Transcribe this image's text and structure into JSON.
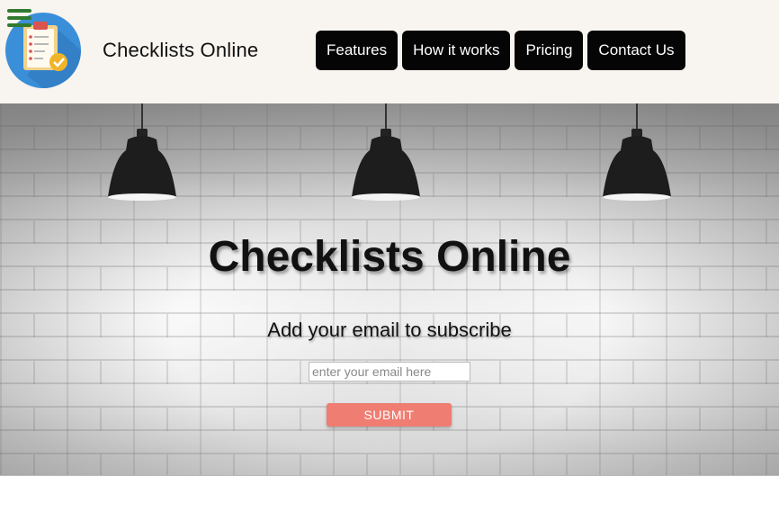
{
  "header": {
    "menu_icon": "hamburger-menu-icon",
    "logo_icon": "clipboard-checklist-logo-icon",
    "brand": "Checklists Online",
    "nav": [
      {
        "label": "Features"
      },
      {
        "label": "How it works"
      },
      {
        "label": "Pricing"
      },
      {
        "label": "Contact Us"
      }
    ]
  },
  "hero": {
    "title": "Checklists Online",
    "subscribe_label": "Add your email to subscribe",
    "email_placeholder": "enter your email here",
    "email_value": "",
    "submit_label": "SUBMIT"
  },
  "colors": {
    "header_bg": "#f8f4ef",
    "nav_button_bg": "#050505",
    "submit_bg": "#ef7d72",
    "menu_icon": "#2f7a2f",
    "logo_circle": "#3a8fd8"
  }
}
